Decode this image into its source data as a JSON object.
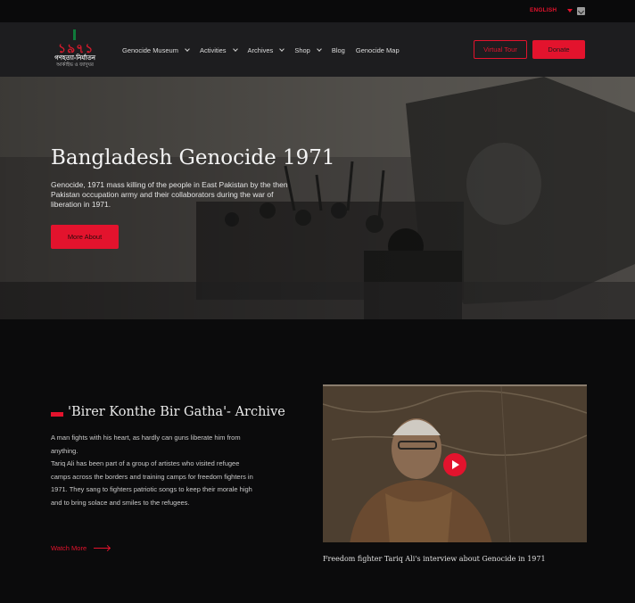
{
  "topbar": {
    "language": "ENGLISH"
  },
  "logo": {
    "numerals": "১৯৭১",
    "line1": "গণহত্যা-নির্যাতন",
    "line2": "আর্কাইভ ও জাদুঘর"
  },
  "nav": {
    "items": [
      {
        "label": "Genocide Museum",
        "dropdown": true
      },
      {
        "label": "Activities",
        "dropdown": true
      },
      {
        "label": "Archives",
        "dropdown": true
      },
      {
        "label": "Shop",
        "dropdown": true
      },
      {
        "label": "Blog",
        "dropdown": false
      },
      {
        "label": "Genocide Map",
        "dropdown": false
      }
    ],
    "virtual_tour": "Virtual Tour",
    "donate": "Donate"
  },
  "hero": {
    "title": "Bangladesh Genocide 1971",
    "description": "Genocide, 1971 mass killing of the people in East Pakistan by the then Pakistan occupation army and their collaborators during the war of liberation in 1971.",
    "button": "More About"
  },
  "archive": {
    "title": "'Birer Konthe Bir Gatha'- Archive",
    "paragraph1": "A man fights with his heart, as hardly can guns liberate him from anything.",
    "paragraph2": "Tariq Ali has been part of a group of artistes who visited refugee camps across the borders and training camps for freedom fighters in 1971. They sang to fighters patriotic songs to keep their morale high and to bring solace and smiles to the refugees.",
    "watch_more": "Watch More",
    "video_caption": "Freedom fighter Tariq Ali's interview about Genocide in 1971"
  },
  "colors": {
    "accent": "#e3132d",
    "header_bg": "#1d1d1f",
    "page_bg": "#0b0b0c"
  }
}
